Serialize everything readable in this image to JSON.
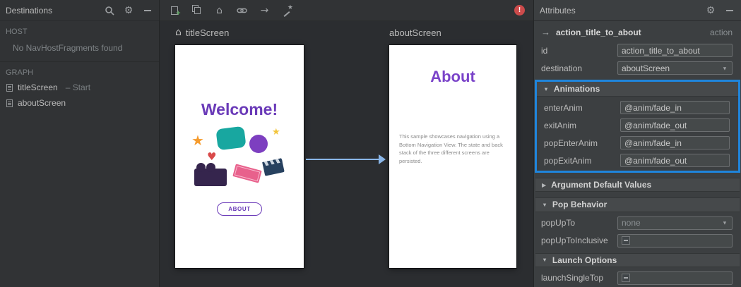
{
  "destinations_panel": {
    "title": "Destinations",
    "host": {
      "label": "HOST",
      "empty_message": "No NavHostFragments found"
    },
    "graph": {
      "label": "GRAPH",
      "items": [
        {
          "name": "titleScreen",
          "suffix": "– Start"
        },
        {
          "name": "aboutScreen",
          "suffix": ""
        }
      ]
    }
  },
  "editor": {
    "screens": [
      {
        "title": "titleScreen",
        "heading": "Welcome!",
        "button_label": "ABOUT"
      },
      {
        "title": "aboutScreen",
        "heading": "About",
        "body": "This sample showcases navigation using a Bottom Navigation View. The state and back stack of the three different screens are persisted."
      }
    ]
  },
  "attributes_panel": {
    "title": "Attributes",
    "action": {
      "name": "action_title_to_about",
      "type": "action"
    },
    "fields": {
      "id": {
        "label": "id",
        "value": "action_title_to_about"
      },
      "destination": {
        "label": "destination",
        "value": "aboutScreen"
      }
    },
    "animations": {
      "title": "Animations",
      "rows": [
        {
          "label": "enterAnim",
          "value": "@anim/fade_in"
        },
        {
          "label": "exitAnim",
          "value": "@anim/fade_out"
        },
        {
          "label": "popEnterAnim",
          "value": "@anim/fade_in"
        },
        {
          "label": "popExitAnim",
          "value": "@anim/fade_out"
        }
      ]
    },
    "argument_defaults": {
      "title": "Argument Default Values"
    },
    "pop_behavior": {
      "title": "Pop Behavior",
      "pop_up_to": {
        "label": "popUpTo",
        "value": "none"
      },
      "pop_up_to_inclusive": {
        "label": "popUpToInclusive"
      }
    },
    "launch_options": {
      "title": "Launch Options",
      "launch_single_top": {
        "label": "launchSingleTop"
      }
    }
  },
  "icons": {
    "home": "⌂",
    "arrow_right": "→",
    "caret_down": "▼",
    "caret_right": "▶",
    "dropdown_arrow": "▼",
    "gear": "⚙",
    "error": "!",
    "star": "★",
    "heart": "♥"
  },
  "colors": {
    "selection_blue": "#1f85dc",
    "accent_purple": "#6a3ab8",
    "arrow_blue": "#8ab6e8",
    "error_red": "#cc4b4b"
  }
}
